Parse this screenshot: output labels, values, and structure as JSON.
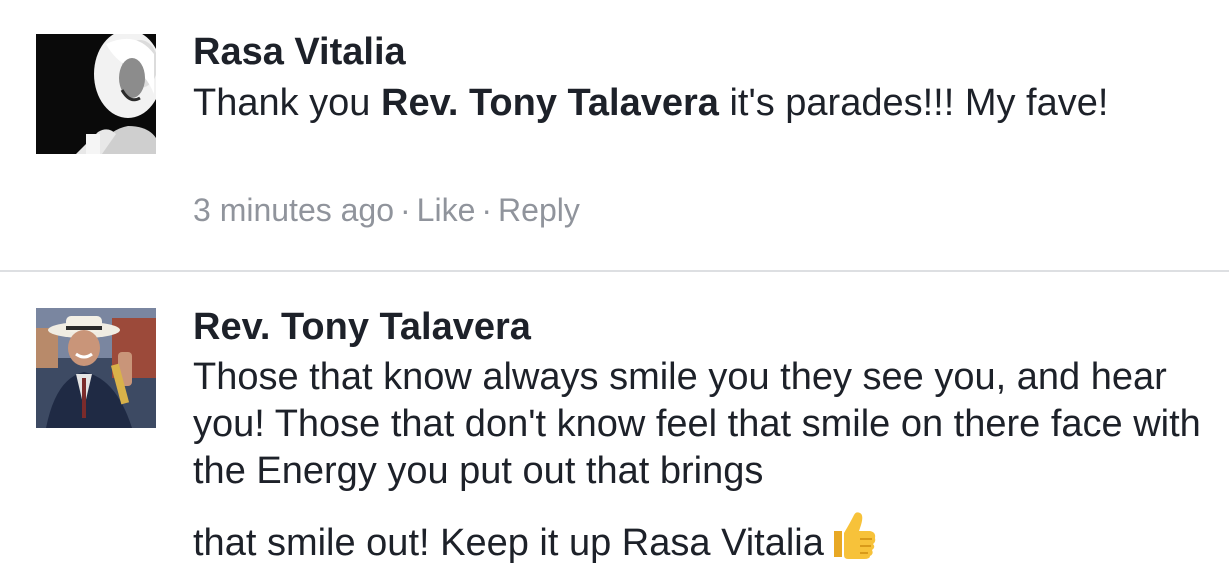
{
  "comments": [
    {
      "author": "Rasa Vitalia",
      "text_before": "Thank you ",
      "mention": "Rev. Tony Talavera",
      "text_after": " it's parades!!! My fave!",
      "timestamp": "3 minutes ago",
      "separator": "·",
      "like_label": "Like",
      "reply_label": "Reply"
    },
    {
      "author": "Rev. Tony Talavera",
      "text_main": "Those that know always smile you they see you, and hear you! Those that don't know feel that smile on there face with the Energy you put out that brings",
      "text_last": "that smile out! Keep it up Rasa Vitalia",
      "emoji": "thumbs-up-icon"
    }
  ],
  "colors": {
    "text": "#1d2129",
    "meta": "#90949c",
    "divider": "#dddfe2",
    "emoji": "#f7c23a"
  }
}
